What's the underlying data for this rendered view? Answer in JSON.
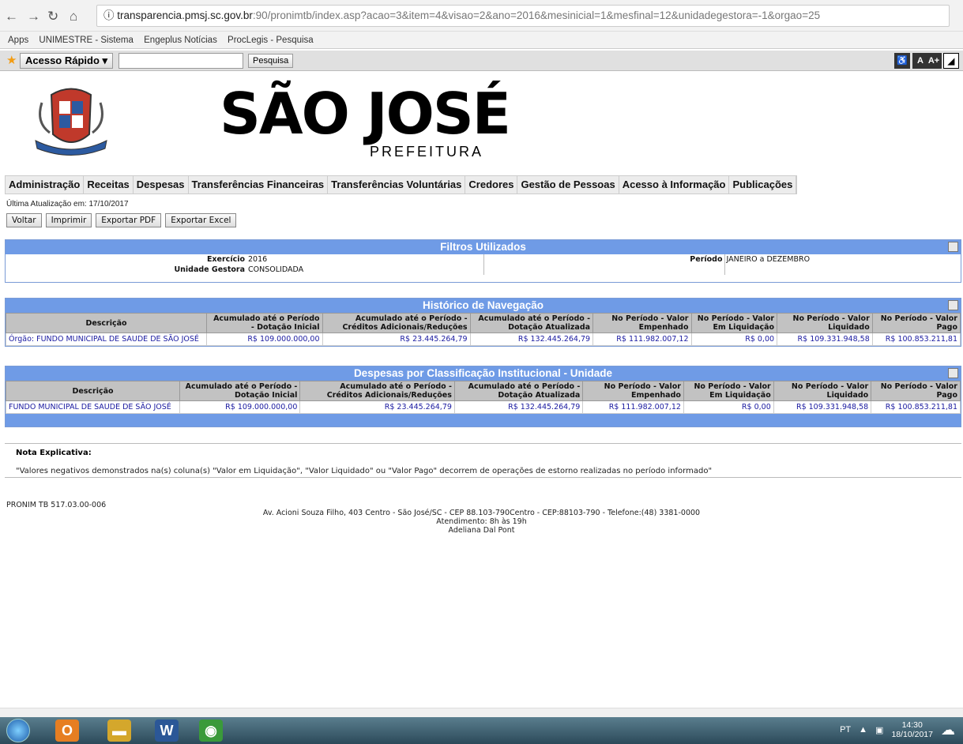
{
  "browser": {
    "url_host": "transparencia.pmsj.sc.gov.br",
    "url_rest": ":90/pronimtb/index.asp?acao=3&item=4&visao=2&ano=2016&mesinicial=1&mesfinal=12&unidadegestora=-1&orgao=25",
    "bookmarks": [
      "Apps",
      "UNIMESTRE - Sistema",
      "Engeplus Notícias",
      "ProcLegis - Pesquisa"
    ]
  },
  "accessbar": {
    "quick_access": "Acesso Rápido ▾",
    "search_button": "Pesquisa",
    "a11y": [
      "♿",
      "A",
      "A+",
      "◢"
    ]
  },
  "header": {
    "brand": "SÃO JOSÉ",
    "subbrand": "PREFEITURA"
  },
  "menu": [
    "Administração",
    "Receitas",
    "Despesas",
    "Transferências Financeiras",
    "Transferências Voluntárias",
    "Credores",
    "Gestão de Pessoas",
    "Acesso à Informação",
    "Publicações"
  ],
  "updated": "Última Atualização em: 17/10/2017",
  "actions": [
    "Voltar",
    "Imprimir",
    "Exportar PDF",
    "Exportar Excel"
  ],
  "filters": {
    "title": "Filtros Utilizados",
    "exercicio_label": "Exercício",
    "exercicio": "2016",
    "unidade_label": "Unidade Gestora",
    "unidade": "CONSOLIDADA",
    "periodo_label": "Período",
    "periodo": "JANEIRO a DEZEMBRO"
  },
  "columns": [
    "Descrição",
    "Acumulado até o Período - Dotação Inicial",
    "Acumulado até o Período - Créditos Adicionais/Reduções",
    "Acumulado até o Período - Dotação Atualizada",
    "No Período - Valor Empenhado",
    "No Período - Valor Em Liquidação",
    "No Período - Valor Liquidado",
    "No Período - Valor Pago"
  ],
  "historico": {
    "title": "Histórico de Navegação",
    "row": [
      "Órgão: FUNDO MUNICIPAL DE SAUDE DE SÃO JOSÉ",
      "R$ 109.000.000,00",
      "R$ 23.445.264,79",
      "R$ 132.445.264,79",
      "R$ 111.982.007,12",
      "R$ 0,00",
      "R$ 109.331.948,58",
      "R$ 100.853.211,81"
    ]
  },
  "despesas": {
    "title": "Despesas por Classificação Institucional - Unidade",
    "row": [
      "FUNDO MUNICIPAL DE SAUDE DE SÃO JOSÉ",
      "R$ 109.000.000,00",
      "R$ 23.445.264,79",
      "R$ 132.445.264,79",
      "R$ 111.982.007,12",
      "R$ 0,00",
      "R$ 109.331.948,58",
      "R$ 100.853.211,81"
    ]
  },
  "note": {
    "heading": "Nota Explicativa:",
    "text": "\"Valores negativos demonstrados na(s) coluna(s) \"Valor em Liquidação\", \"Valor Liquidado\" ou \"Valor Pago\" decorrem de operações de estorno realizadas no período informado\""
  },
  "footer": {
    "version": "PRONIM TB 517.03.00-006",
    "address": "Av. Acioni Souza Filho, 403 Centro - São José/SC - CEP 88.103-790Centro - CEP:88103-790 - Telefone:(48) 3381-0000",
    "hours": "Atendimento: 8h às 19h",
    "name": "Adeliana Dal Pont"
  },
  "taskbar": {
    "lang": "PT",
    "time": "14:30",
    "date": "18/10/2017"
  }
}
